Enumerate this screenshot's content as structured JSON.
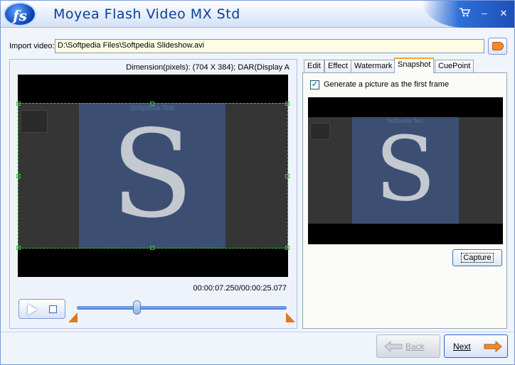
{
  "window": {
    "title": "Moyea Flash Video MX Std",
    "logo_text": "fs",
    "controls": {
      "cart_icon": "shopping-cart-icon",
      "minimize_symbol": "–",
      "close_symbol": "✕"
    }
  },
  "import": {
    "label": "Import video:",
    "path": "D:\\Softpedia Files\\Softpedia Slideshow.avi",
    "browse_icon": "tag-icon"
  },
  "preview": {
    "dimension_text": "Dimension(pixels): (704 X 384);  DAR(Display A",
    "frame_caption": "Softpedia Test",
    "frame_letter": "S",
    "time_text": "00:00:07.250/00:00:25.077",
    "playback_progress_fraction": 0.289
  },
  "tabs": [
    {
      "label": "Edit",
      "active": false
    },
    {
      "label": "Effect",
      "active": false
    },
    {
      "label": "Watermark",
      "active": false
    },
    {
      "label": "Snapshot",
      "active": true
    },
    {
      "label": "CuePoint",
      "active": false
    }
  ],
  "snapshot": {
    "checkbox_label": "Generate a picture as the first frame",
    "checked": true,
    "check_mark": "✓",
    "capture_label": "Capture",
    "watermark_text": "SOFTPEDIA"
  },
  "footer": {
    "back_label": "Back",
    "next_label": "Next"
  },
  "colors": {
    "title_text": "#0d3f91",
    "accent_orange": "#e07820",
    "selection_green": "#40c040",
    "active_tab_top": "#f5a623"
  }
}
